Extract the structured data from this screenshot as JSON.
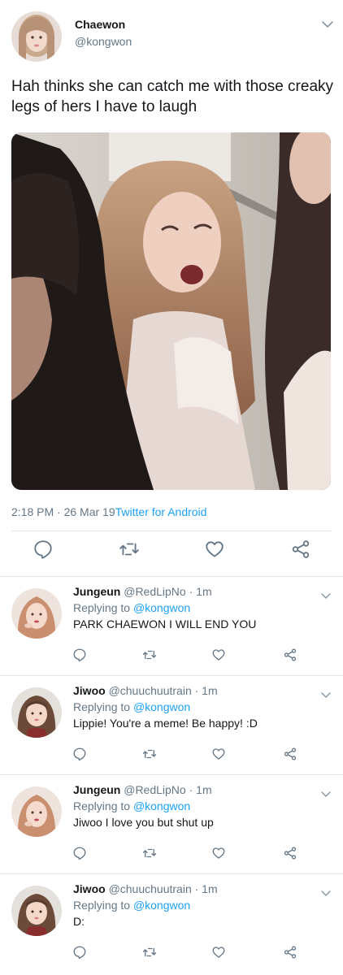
{
  "main_tweet": {
    "author_name": "Chaewon",
    "author_handle": "@kongwon",
    "text": "Hah thinks she can catch me with those creaky legs of hers I have to laugh",
    "time": "2:18 PM · 26 Mar 19",
    "source": "Twitter for Android"
  },
  "replies": [
    {
      "name": "Jungeun",
      "handle": "@RedLipNo",
      "age": "· 1m",
      "replying_prefix": "Replying to ",
      "replying_to": "@kongwon",
      "text": "PARK CHAEWON I WILL END YOU"
    },
    {
      "name": "Jiwoo",
      "handle": "@chuuchuutrain",
      "age": "· 1m",
      "replying_prefix": "Replying to ",
      "replying_to": "@kongwon",
      "text": "Lippie! You're a meme! Be happy! :D"
    },
    {
      "name": "Jungeun",
      "handle": "@RedLipNo",
      "age": "· 1m",
      "replying_prefix": "Replying to ",
      "replying_to": "@kongwon",
      "text": "Jiwoo I love you but shut up"
    },
    {
      "name": "Jiwoo",
      "handle": "@chuuchuutrain",
      "age": "· 1m",
      "replying_prefix": "Replying to ",
      "replying_to": "@kongwon",
      "text": "D:"
    }
  ],
  "icons": {
    "reply": "reply-icon",
    "retweet": "retweet-icon",
    "like": "heart-icon",
    "share": "share-icon",
    "menu": "chevron-down-icon"
  },
  "colors": {
    "text": "#14171a",
    "secondary": "#657786",
    "link": "#1da1f2",
    "divider": "#e1e8ed"
  }
}
